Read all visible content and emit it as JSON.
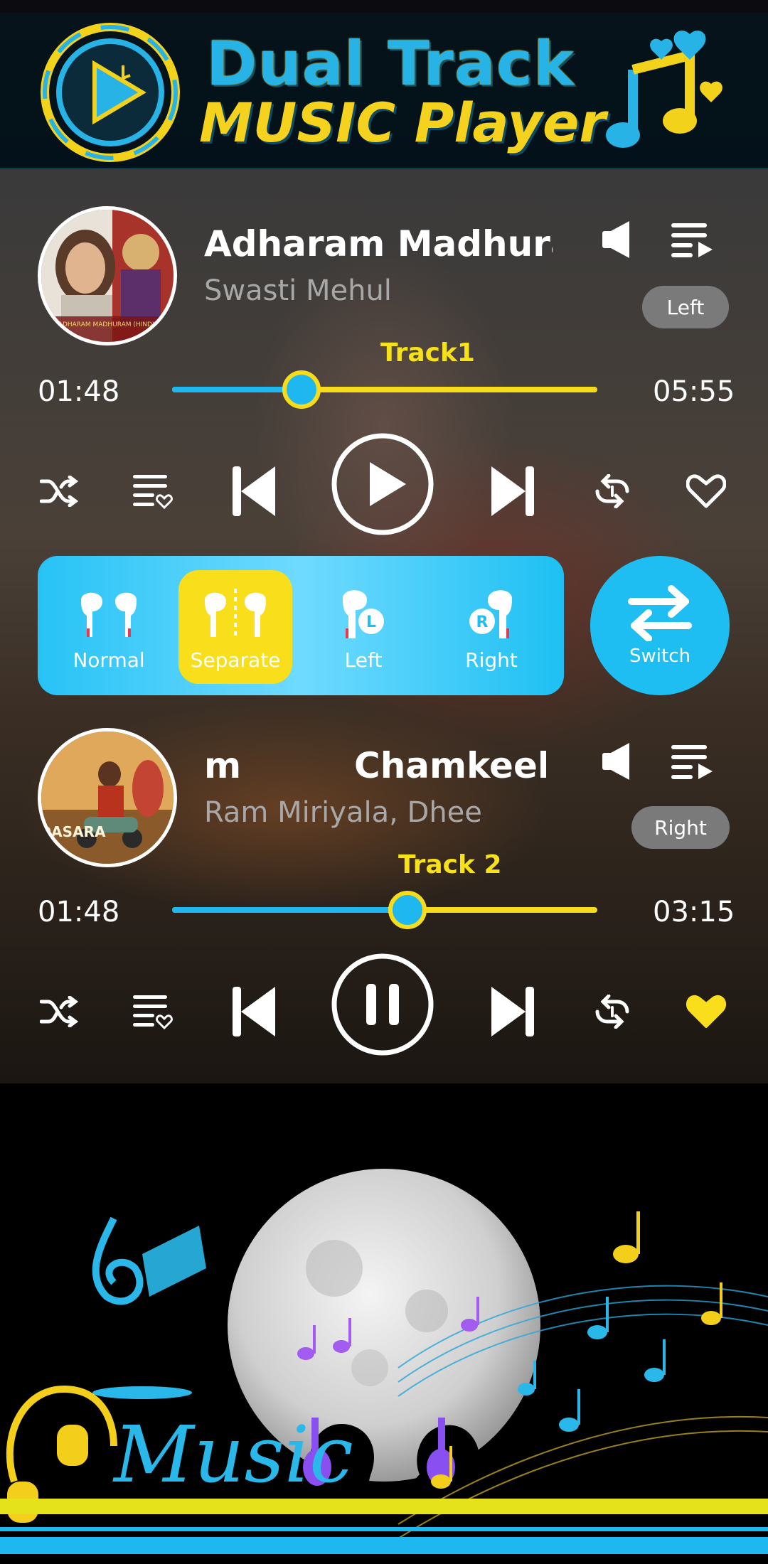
{
  "app": {
    "banner_line1": "Dual Track",
    "banner_line2": "MUSIC Player"
  },
  "colors": {
    "accent_blue": "#1eb7f0",
    "accent_yellow": "#f6dc1a",
    "pill_gray": "#7a7a7a"
  },
  "track1": {
    "label": "Track1",
    "title": "Adharam Madhuram",
    "artist": "Swasti Mehul",
    "channel": "Left",
    "elapsed": "01:48",
    "duration": "05:55",
    "progress": 0.305,
    "playing": false,
    "favorite": false,
    "album_caption": "ADHARAM MADHURAM (HINDI)"
  },
  "track2": {
    "label": "Track 2",
    "title_fragment": "m",
    "title": "Chamkeela",
    "artist": "Ram Miriyala, Dhee",
    "channel": "Right",
    "elapsed": "01:48",
    "duration": "03:15",
    "progress": 0.553,
    "playing": true,
    "favorite": true,
    "album_caption": "DASARA"
  },
  "modes": [
    {
      "label": "Normal",
      "icon": "earbuds-icon",
      "active": false
    },
    {
      "label": "Separate",
      "icon": "earbuds-separate-icon",
      "active": true
    },
    {
      "label": "Left",
      "icon": "left-earbud-icon",
      "active": false
    },
    {
      "label": "Right",
      "icon": "right-earbud-icon",
      "active": false
    }
  ],
  "switch": {
    "label": "Switch",
    "icon": "swap-arrows-icon"
  },
  "bottom_art": {
    "word": "Music"
  }
}
